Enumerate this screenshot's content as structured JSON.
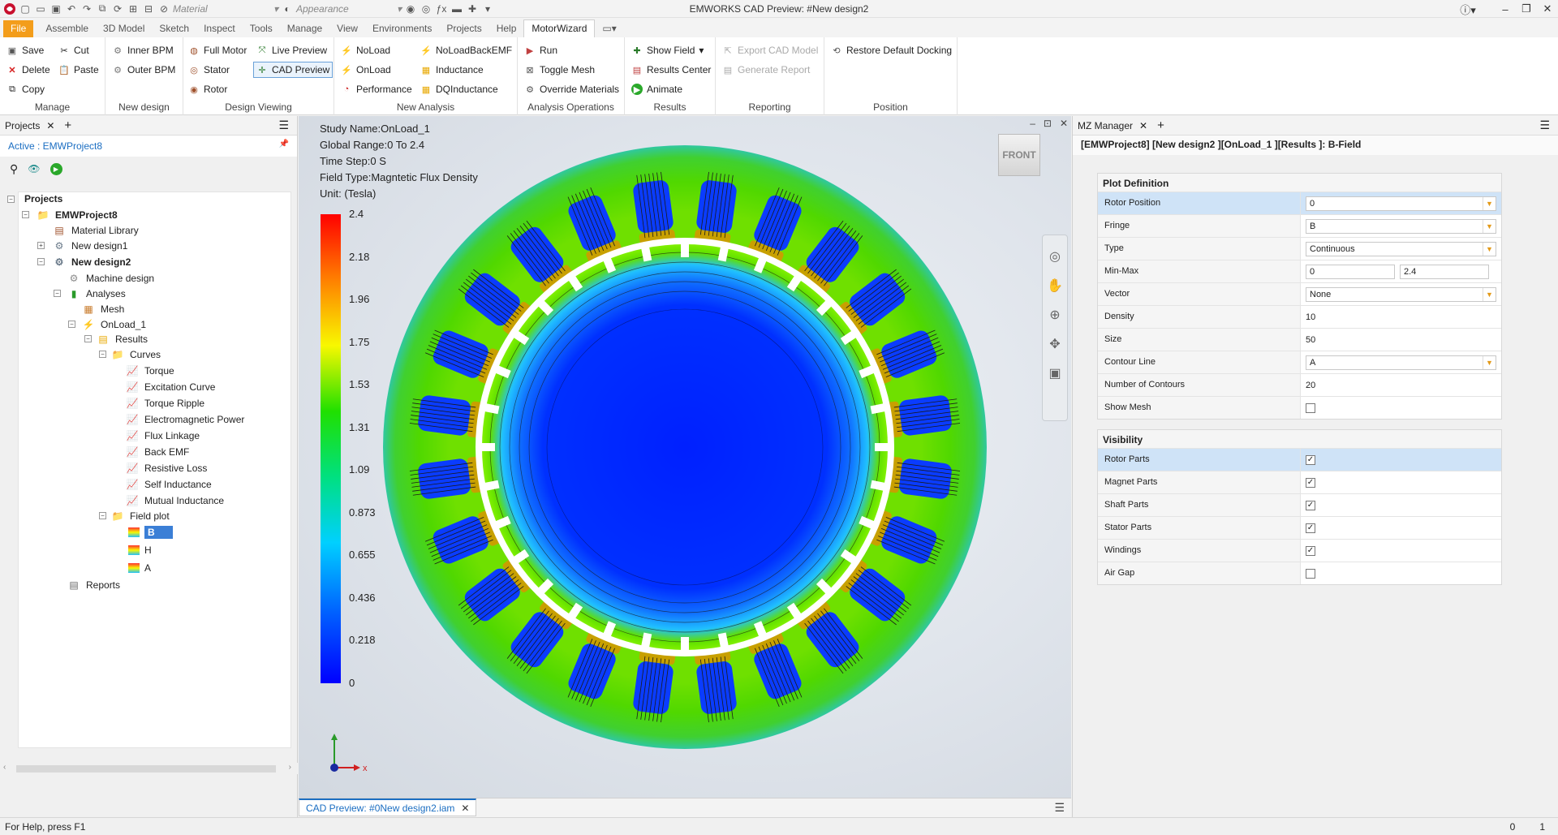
{
  "window": {
    "title": "EMWORKS   CAD Preview: #New design2"
  },
  "qat": {
    "material_label": "Material",
    "appearance_label": "Appearance"
  },
  "menus": [
    "File",
    "Assemble",
    "3D Model",
    "Sketch",
    "Inspect",
    "Tools",
    "Manage",
    "View",
    "Environments",
    "Projects",
    "Help",
    "MotorWizard"
  ],
  "ribbon": {
    "manage": {
      "title": "Manage",
      "save": "Save",
      "cut": "Cut",
      "delete": "Delete",
      "paste": "Paste",
      "copy": "Copy"
    },
    "new_design": {
      "title": "New design",
      "inner": "Inner BPM",
      "outer": "Outer BPM"
    },
    "design_viewing": {
      "title": "Design Viewing",
      "full_motor": "Full Motor",
      "live_preview": "Live Preview",
      "stator": "Stator",
      "cad_preview": "CAD Preview",
      "rotor": "Rotor"
    },
    "new_analysis": {
      "title": "New Analysis",
      "noload": "NoLoad",
      "noloadbackemf": "NoLoadBackEMF",
      "onload": "OnLoad",
      "inductance": "Inductance",
      "performance": "Performance",
      "dqinductance": "DQInductance"
    },
    "analysis_ops": {
      "title": "Analysis Operations",
      "run": "Run",
      "toggle_mesh": "Toggle Mesh",
      "override": "Override Materials"
    },
    "results": {
      "title": "Results",
      "show_field": "Show Field",
      "results_center": "Results Center",
      "animate": "Animate"
    },
    "reporting": {
      "title": "Reporting",
      "export_cad": "Export CAD Model",
      "generate_report": "Generate Report"
    },
    "position": {
      "title": "Position",
      "restore": "Restore Default Docking"
    }
  },
  "left_panel": {
    "tab_label": "Projects",
    "active": "Active : EMWProject8",
    "tree": {
      "root": "Projects",
      "project": "EMWProject8",
      "material_library": "Material Library",
      "design1": "New design1",
      "design2": "New design2",
      "machine_design": "Machine design",
      "analyses": "Analyses",
      "mesh": "Mesh",
      "onload": "OnLoad_1",
      "results": "Results",
      "curves": "Curves",
      "curve_items": [
        "Torque",
        "Excitation Curve",
        "Torque Ripple",
        "Electromagnetic Power",
        "Flux Linkage",
        "Back EMF",
        "Resistive Loss",
        "Self Inductance",
        "Mutual Inductance"
      ],
      "field_plot": "Field plot",
      "fields": [
        "B",
        "H",
        "A"
      ],
      "reports": "Reports"
    }
  },
  "viewport": {
    "info": [
      "Study Name:OnLoad_1",
      "Global Range:0 To 2.4",
      "Time Step:0 S",
      "Field Type:Magntetic Flux Density",
      "Unit: (Tesla)"
    ],
    "legend_ticks": [
      "2.4",
      "2.18",
      "1.96",
      "1.75",
      "1.53",
      "1.31",
      "1.09",
      "0.873",
      "0.655",
      "0.436",
      "0.218",
      "0"
    ],
    "viewcube": "FRONT",
    "axis_x": "x",
    "doc_tab": "CAD Preview: #0New design2.iam"
  },
  "right_panel": {
    "tab_label": "MZ Manager",
    "path": "[EMWProject8] [New design2 ][OnLoad_1 ][Results ]: B-Field",
    "plot_def_title": "Plot Definition",
    "rotor_position_label": "Rotor Position",
    "rotor_position_value": "0",
    "fringe_label": "Fringe",
    "fringe_value": "B",
    "type_label": "Type",
    "type_value": "Continuous",
    "minmax_label": "Min-Max",
    "min_value": "0",
    "max_value": "2.4",
    "vector_label": "Vector",
    "vector_value": "None",
    "density_label": "Density",
    "density_value": "10",
    "size_label": "Size",
    "size_value": "50",
    "contour_label": "Contour Line",
    "contour_value": "A",
    "num_contours_label": "Number of Contours",
    "num_contours_value": "20",
    "show_mesh_label": "Show Mesh",
    "visibility_title": "Visibility",
    "rotor_parts": "Rotor Parts",
    "magnet_parts": "Magnet Parts",
    "shaft_parts": "Shaft Parts",
    "stator_parts": "Stator Parts",
    "windings": "Windings",
    "air_gap": "Air Gap"
  },
  "status": {
    "help": "For Help, press F1",
    "c1": "0",
    "c2": "1"
  },
  "colors": {
    "accent": "#1b6ec2",
    "file_tab": "#f39d1b",
    "selection": "#cfe3f7"
  }
}
